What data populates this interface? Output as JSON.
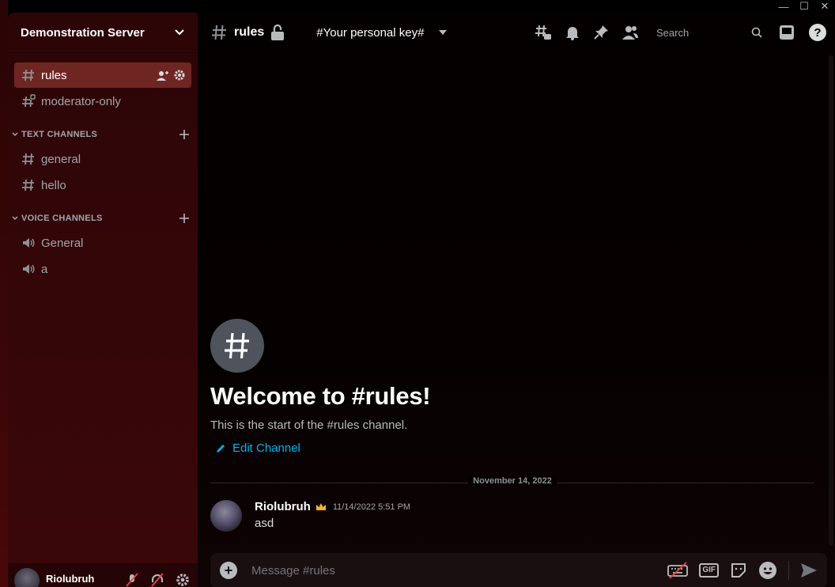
{
  "window": {
    "minimize": "—",
    "maximize": "☐",
    "close": "✕"
  },
  "server": {
    "name": "Demonstration Server"
  },
  "sidebar": {
    "top_channels": [
      {
        "label": "rules",
        "active": true
      },
      {
        "label": "moderator-only",
        "active": false
      }
    ],
    "categories": [
      {
        "title": "TEXT CHANNELS",
        "channels": [
          "general",
          "hello"
        ]
      },
      {
        "title": "VOICE CHANNELS",
        "channels": [
          "General",
          "a"
        ]
      }
    ]
  },
  "user": {
    "name": "Riolubruh"
  },
  "header": {
    "channel": "rules",
    "key_label": "#Your personal key#",
    "search_placeholder": "Search"
  },
  "welcome": {
    "title": "Welcome to #rules!",
    "subtitle": "This is the start of the #rules channel.",
    "edit_label": "Edit Channel"
  },
  "divider": {
    "date": "November 14, 2022"
  },
  "message": {
    "author": "Riolubruh",
    "timestamp": "11/14/2022 5:51 PM",
    "text": "asd"
  },
  "composer": {
    "placeholder": "Message #rules",
    "gif_label": "GIF"
  },
  "colors": {
    "accent": "#00b0f4",
    "crown": "#f0b232",
    "active_channel": "#8a3a34"
  }
}
